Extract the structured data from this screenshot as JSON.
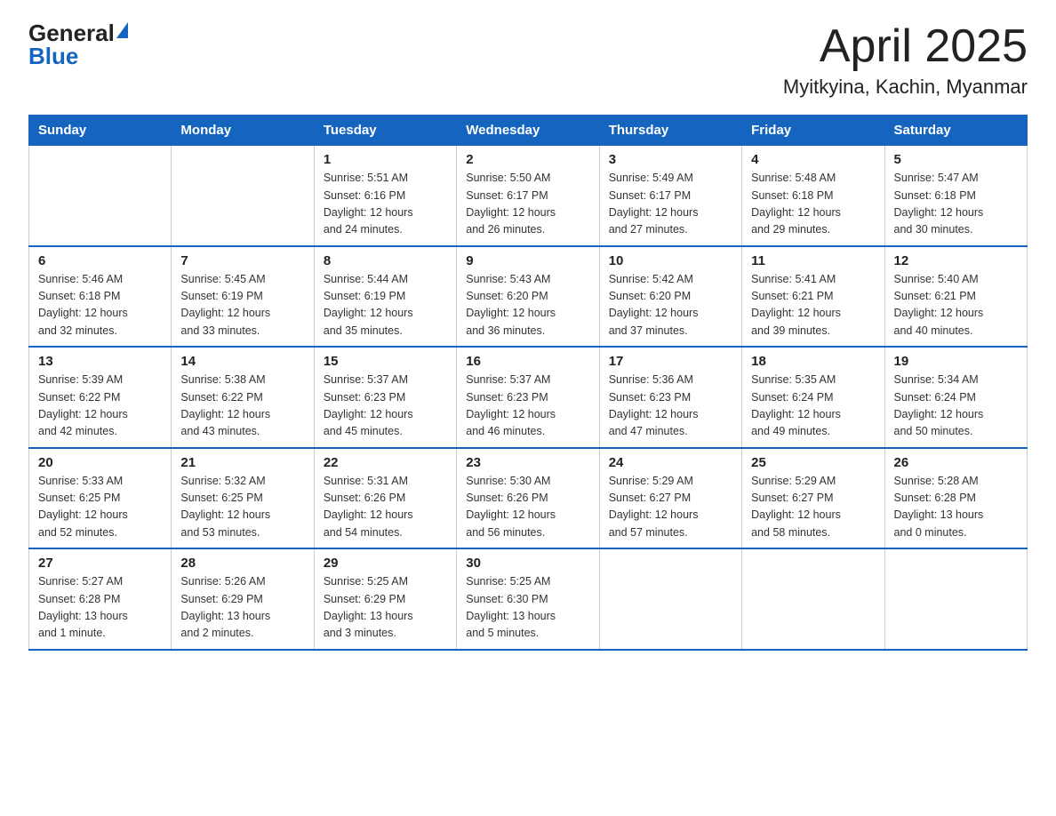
{
  "header": {
    "logo_general": "General",
    "logo_blue": "Blue",
    "title": "April 2025",
    "subtitle": "Myitkyina, Kachin, Myanmar"
  },
  "weekdays": [
    "Sunday",
    "Monday",
    "Tuesday",
    "Wednesday",
    "Thursday",
    "Friday",
    "Saturday"
  ],
  "weeks": [
    [
      {
        "day": "",
        "info": ""
      },
      {
        "day": "",
        "info": ""
      },
      {
        "day": "1",
        "info": "Sunrise: 5:51 AM\nSunset: 6:16 PM\nDaylight: 12 hours\nand 24 minutes."
      },
      {
        "day": "2",
        "info": "Sunrise: 5:50 AM\nSunset: 6:17 PM\nDaylight: 12 hours\nand 26 minutes."
      },
      {
        "day": "3",
        "info": "Sunrise: 5:49 AM\nSunset: 6:17 PM\nDaylight: 12 hours\nand 27 minutes."
      },
      {
        "day": "4",
        "info": "Sunrise: 5:48 AM\nSunset: 6:18 PM\nDaylight: 12 hours\nand 29 minutes."
      },
      {
        "day": "5",
        "info": "Sunrise: 5:47 AM\nSunset: 6:18 PM\nDaylight: 12 hours\nand 30 minutes."
      }
    ],
    [
      {
        "day": "6",
        "info": "Sunrise: 5:46 AM\nSunset: 6:18 PM\nDaylight: 12 hours\nand 32 minutes."
      },
      {
        "day": "7",
        "info": "Sunrise: 5:45 AM\nSunset: 6:19 PM\nDaylight: 12 hours\nand 33 minutes."
      },
      {
        "day": "8",
        "info": "Sunrise: 5:44 AM\nSunset: 6:19 PM\nDaylight: 12 hours\nand 35 minutes."
      },
      {
        "day": "9",
        "info": "Sunrise: 5:43 AM\nSunset: 6:20 PM\nDaylight: 12 hours\nand 36 minutes."
      },
      {
        "day": "10",
        "info": "Sunrise: 5:42 AM\nSunset: 6:20 PM\nDaylight: 12 hours\nand 37 minutes."
      },
      {
        "day": "11",
        "info": "Sunrise: 5:41 AM\nSunset: 6:21 PM\nDaylight: 12 hours\nand 39 minutes."
      },
      {
        "day": "12",
        "info": "Sunrise: 5:40 AM\nSunset: 6:21 PM\nDaylight: 12 hours\nand 40 minutes."
      }
    ],
    [
      {
        "day": "13",
        "info": "Sunrise: 5:39 AM\nSunset: 6:22 PM\nDaylight: 12 hours\nand 42 minutes."
      },
      {
        "day": "14",
        "info": "Sunrise: 5:38 AM\nSunset: 6:22 PM\nDaylight: 12 hours\nand 43 minutes."
      },
      {
        "day": "15",
        "info": "Sunrise: 5:37 AM\nSunset: 6:23 PM\nDaylight: 12 hours\nand 45 minutes."
      },
      {
        "day": "16",
        "info": "Sunrise: 5:37 AM\nSunset: 6:23 PM\nDaylight: 12 hours\nand 46 minutes."
      },
      {
        "day": "17",
        "info": "Sunrise: 5:36 AM\nSunset: 6:23 PM\nDaylight: 12 hours\nand 47 minutes."
      },
      {
        "day": "18",
        "info": "Sunrise: 5:35 AM\nSunset: 6:24 PM\nDaylight: 12 hours\nand 49 minutes."
      },
      {
        "day": "19",
        "info": "Sunrise: 5:34 AM\nSunset: 6:24 PM\nDaylight: 12 hours\nand 50 minutes."
      }
    ],
    [
      {
        "day": "20",
        "info": "Sunrise: 5:33 AM\nSunset: 6:25 PM\nDaylight: 12 hours\nand 52 minutes."
      },
      {
        "day": "21",
        "info": "Sunrise: 5:32 AM\nSunset: 6:25 PM\nDaylight: 12 hours\nand 53 minutes."
      },
      {
        "day": "22",
        "info": "Sunrise: 5:31 AM\nSunset: 6:26 PM\nDaylight: 12 hours\nand 54 minutes."
      },
      {
        "day": "23",
        "info": "Sunrise: 5:30 AM\nSunset: 6:26 PM\nDaylight: 12 hours\nand 56 minutes."
      },
      {
        "day": "24",
        "info": "Sunrise: 5:29 AM\nSunset: 6:27 PM\nDaylight: 12 hours\nand 57 minutes."
      },
      {
        "day": "25",
        "info": "Sunrise: 5:29 AM\nSunset: 6:27 PM\nDaylight: 12 hours\nand 58 minutes."
      },
      {
        "day": "26",
        "info": "Sunrise: 5:28 AM\nSunset: 6:28 PM\nDaylight: 13 hours\nand 0 minutes."
      }
    ],
    [
      {
        "day": "27",
        "info": "Sunrise: 5:27 AM\nSunset: 6:28 PM\nDaylight: 13 hours\nand 1 minute."
      },
      {
        "day": "28",
        "info": "Sunrise: 5:26 AM\nSunset: 6:29 PM\nDaylight: 13 hours\nand 2 minutes."
      },
      {
        "day": "29",
        "info": "Sunrise: 5:25 AM\nSunset: 6:29 PM\nDaylight: 13 hours\nand 3 minutes."
      },
      {
        "day": "30",
        "info": "Sunrise: 5:25 AM\nSunset: 6:30 PM\nDaylight: 13 hours\nand 5 minutes."
      },
      {
        "day": "",
        "info": ""
      },
      {
        "day": "",
        "info": ""
      },
      {
        "day": "",
        "info": ""
      }
    ]
  ]
}
